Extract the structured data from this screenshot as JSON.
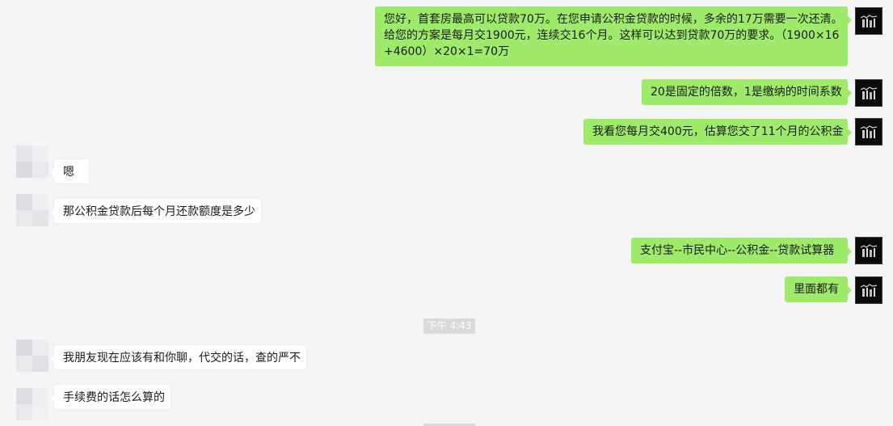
{
  "conversation": {
    "messages": [
      {
        "direction": "out",
        "lines": [
          "您好，首套房最高可以贷款70万。在您申请公积金贷款的时候，多余的17万需要一次还清。",
          "给您的方案是每月交1900元，连续交16个月。这样可以达到贷款70万的要求。（1900×16",
          "+4600）×20×1=70万"
        ]
      },
      {
        "direction": "out",
        "lines": [
          "20是固定的倍数，1是缴纳的时间系数"
        ]
      },
      {
        "direction": "out",
        "lines": [
          "我看您每月交400元，估算您交了11个月的公积金"
        ]
      },
      {
        "direction": "in",
        "lines": [
          "嗯"
        ]
      },
      {
        "direction": "in",
        "lines": [
          "那公积金贷款后每个月还款额度是多少"
        ]
      },
      {
        "direction": "out",
        "lines": [
          "支付宝--市民中心--公积金--贷款试算器"
        ]
      },
      {
        "direction": "out",
        "lines": [
          "里面都有"
        ]
      },
      {
        "direction": "in",
        "lines": [
          "我朋友现在应该有和你聊，代交的话，查的严不"
        ]
      },
      {
        "direction": "in",
        "lines": [
          "手续费的话怎么算的"
        ]
      }
    ],
    "timestamp": "下午 4:43"
  },
  "colors": {
    "background": "#f5f5f5",
    "outgoing_bubble": "#9eea6a",
    "incoming_bubble": "#ffffff",
    "timestamp_pill": "#dadada"
  },
  "icons": {
    "self_avatar": "dark-photo-avatar",
    "contact_avatar": "blurred-avatar"
  }
}
